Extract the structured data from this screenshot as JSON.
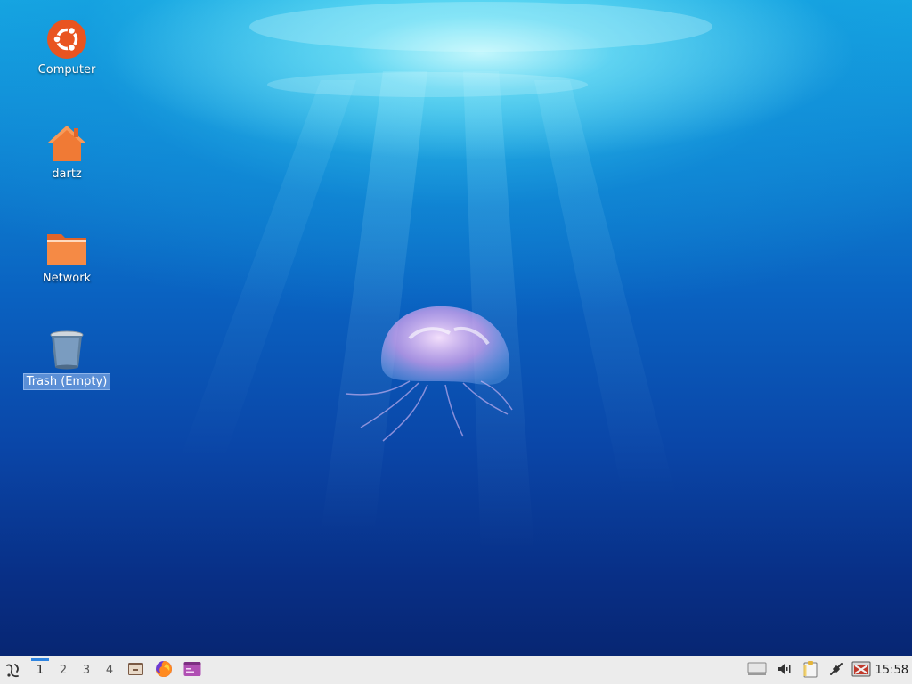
{
  "desktop": {
    "icons": [
      {
        "label": "Computer",
        "icon": "ubuntu-logo-icon"
      },
      {
        "label": "dartz",
        "icon": "home-folder-icon"
      },
      {
        "label": "Network",
        "icon": "folder-icon"
      },
      {
        "label": "Trash (Empty)",
        "icon": "trash-icon",
        "selected": true
      }
    ]
  },
  "taskbar": {
    "menu_icon": "lubuntu-menu-icon",
    "workspaces": [
      "1",
      "2",
      "3",
      "4"
    ],
    "active_workspace": "1",
    "launchers": [
      "file-manager-icon",
      "firefox-icon",
      "terminal-icon"
    ],
    "tray_icons": [
      "removable-drive-icon",
      "volume-icon",
      "clipboard-icon",
      "network-icon",
      "update-notifier-icon"
    ],
    "clock": "15:58"
  },
  "colors": {
    "accent": "#2f84e0",
    "ubuntu_orange": "#e95420",
    "folder_orange": "#f07a35",
    "taskbar_bg": "#ececec",
    "selection": "#5b8fd6"
  }
}
